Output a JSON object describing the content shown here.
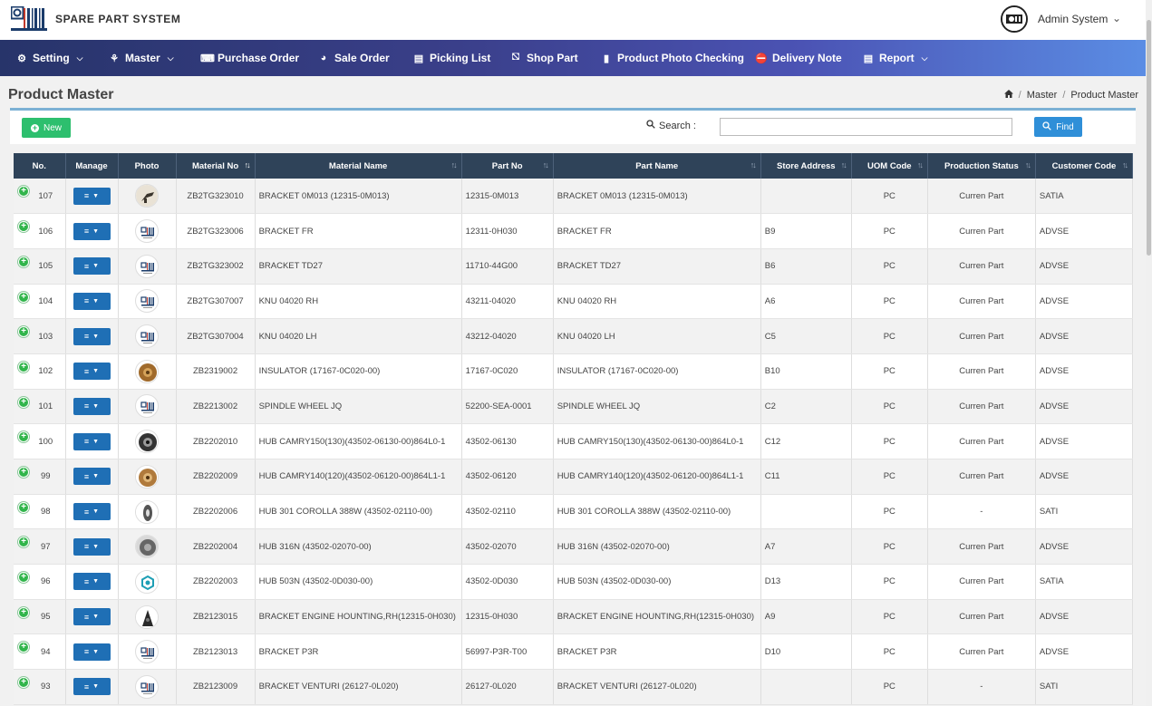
{
  "app": {
    "title": "SPARE PART SYSTEM"
  },
  "user": {
    "name": "Admin System"
  },
  "nav": [
    {
      "label": "Setting",
      "icon": "gears-icon",
      "dropdown": true
    },
    {
      "label": "Master",
      "icon": "sitemap-icon",
      "dropdown": true
    },
    {
      "label": "Purchase Order",
      "icon": "keyboard-icon",
      "dropdown": false
    },
    {
      "label": "Sale Order",
      "icon": "chart-pie-icon",
      "dropdown": false
    },
    {
      "label": "Picking List",
      "icon": "file-icon",
      "dropdown": false
    },
    {
      "label": "Shop Part",
      "icon": "cart-icon",
      "dropdown": false
    },
    {
      "label": "Product Photo Checking",
      "icon": "barcode-icon",
      "dropdown": false
    },
    {
      "label": "Delivery Note",
      "icon": "truck-icon",
      "dropdown": false
    },
    {
      "label": "Report",
      "icon": "report-icon",
      "dropdown": true
    }
  ],
  "page": {
    "title": "Product Master",
    "breadcrumb": [
      "Master",
      "Product Master"
    ]
  },
  "toolbar": {
    "new_label": "New",
    "search_label": "Search :",
    "search_value": "",
    "find_label": "Find"
  },
  "table": {
    "headers": [
      "No.",
      "Manage",
      "Photo",
      "Material No",
      "Material Name",
      "Part No",
      "Part Name",
      "Store Address",
      "UOM Code",
      "Production Status",
      "Customer Code"
    ],
    "rows": [
      {
        "no": "107",
        "photo": "dark-bracket",
        "material_no": "ZB2TG323010",
        "material_name": "BRACKET 0M013 (12315-0M013)",
        "part_no": "12315-0M013",
        "part_name": "BRACKET 0M013 (12315-0M013)",
        "store": "",
        "uom": "PC",
        "status": "Curren Part",
        "customer": "SATIA"
      },
      {
        "no": "106",
        "photo": "placeholder-logo",
        "material_no": "ZB2TG323006",
        "material_name": "BRACKET FR",
        "part_no": "12311-0H030",
        "part_name": "BRACKET FR",
        "store": "B9",
        "uom": "PC",
        "status": "Curren Part",
        "customer": "ADVSE"
      },
      {
        "no": "105",
        "photo": "placeholder-logo",
        "material_no": "ZB2TG323002",
        "material_name": "BRACKET TD27",
        "part_no": "11710-44G00",
        "part_name": "BRACKET TD27",
        "store": "B6",
        "uom": "PC",
        "status": "Curren Part",
        "customer": "ADVSE"
      },
      {
        "no": "104",
        "photo": "placeholder-logo",
        "material_no": "ZB2TG307007",
        "material_name": "KNU 04020 RH",
        "part_no": "43211-04020",
        "part_name": "KNU 04020 RH",
        "store": "A6",
        "uom": "PC",
        "status": "Curren Part",
        "customer": "ADVSE"
      },
      {
        "no": "103",
        "photo": "placeholder-logo",
        "material_no": "ZB2TG307004",
        "material_name": "KNU 04020 LH",
        "part_no": "43212-04020",
        "part_name": "KNU 04020 LH",
        "store": "C5",
        "uom": "PC",
        "status": "Curren Part",
        "customer": "ADVSE"
      },
      {
        "no": "102",
        "photo": "bronze-ring",
        "material_no": "ZB2319002",
        "material_name": "INSULATOR (17167-0C020-00)",
        "part_no": "17167-0C020",
        "part_name": "INSULATOR (17167-0C020-00)",
        "store": "B10",
        "uom": "PC",
        "status": "Curren Part",
        "customer": "ADVSE"
      },
      {
        "no": "101",
        "photo": "placeholder-logo",
        "material_no": "ZB2213002",
        "material_name": "SPINDLE WHEEL JQ",
        "part_no": "52200-SEA-0001",
        "part_name": "SPINDLE WHEEL JQ",
        "store": "C2",
        "uom": "PC",
        "status": "Curren Part",
        "customer": "ADVSE"
      },
      {
        "no": "100",
        "photo": "dark-hub",
        "material_no": "ZB2202010",
        "material_name": "HUB CAMRY150(130)(43502-06130-00)864L0-1",
        "part_no": "43502-06130",
        "part_name": "HUB CAMRY150(130)(43502-06130-00)864L0-1",
        "store": "C12",
        "uom": "PC",
        "status": "Curren Part",
        "customer": "ADVSE"
      },
      {
        "no": "99",
        "photo": "bronze-hub",
        "material_no": "ZB2202009",
        "material_name": "HUB CAMRY140(120)(43502-06120-00)864L1-1",
        "part_no": "43502-06120",
        "part_name": "HUB CAMRY140(120)(43502-06120-00)864L1-1",
        "store": "C11",
        "uom": "PC",
        "status": "Curren Part",
        "customer": "ADVSE"
      },
      {
        "no": "98",
        "photo": "grey-part",
        "material_no": "ZB2202006",
        "material_name": "HUB 301 COROLLA 388W (43502-02110-00)",
        "part_no": "43502-02110",
        "part_name": "HUB 301 COROLLA 388W (43502-02110-00)",
        "store": "",
        "uom": "PC",
        "status": "-",
        "customer": "SATI"
      },
      {
        "no": "97",
        "photo": "grey-hub",
        "material_no": "ZB2202004",
        "material_name": "HUB 316N (43502-02070-00)",
        "part_no": "43502-02070",
        "part_name": "HUB 316N (43502-02070-00)",
        "store": "A7",
        "uom": "PC",
        "status": "Curren Part",
        "customer": "ADVSE"
      },
      {
        "no": "96",
        "photo": "teal-hex",
        "material_no": "ZB2202003",
        "material_name": "HUB 503N (43502-0D030-00)",
        "part_no": "43502-0D030",
        "part_name": "HUB 503N (43502-0D030-00)",
        "store": "D13",
        "uom": "PC",
        "status": "Curren Part",
        "customer": "SATIA"
      },
      {
        "no": "95",
        "photo": "dark-cone",
        "material_no": "ZB2123015",
        "material_name": "BRACKET ENGINE HOUNTING,RH(12315-0H030)",
        "part_no": "12315-0H030",
        "part_name": "BRACKET ENGINE HOUNTING,RH(12315-0H030)",
        "store": "A9",
        "uom": "PC",
        "status": "Curren Part",
        "customer": "ADVSE"
      },
      {
        "no": "94",
        "photo": "placeholder-logo",
        "material_no": "ZB2123013",
        "material_name": "BRACKET P3R",
        "part_no": "56997-P3R-T00",
        "part_name": "BRACKET P3R",
        "store": "D10",
        "uom": "PC",
        "status": "Curren Part",
        "customer": "ADVSE"
      },
      {
        "no": "93",
        "photo": "placeholder-logo",
        "material_no": "ZB2123009",
        "material_name": "BRACKET VENTURI (26127-0L020)",
        "part_no": "26127-0L020",
        "part_name": "BRACKET VENTURI (26127-0L020)",
        "store": "",
        "uom": "PC",
        "status": "-",
        "customer": "SATI"
      }
    ]
  },
  "colors": {
    "nav_start": "#27346a",
    "nav_end": "#5b8de4",
    "table_header": "#2f4359",
    "new_button": "#2dbf6e",
    "find_button": "#2f8fd8",
    "manage_button": "#1f6fb5",
    "expand_icon": "#31b54b"
  }
}
